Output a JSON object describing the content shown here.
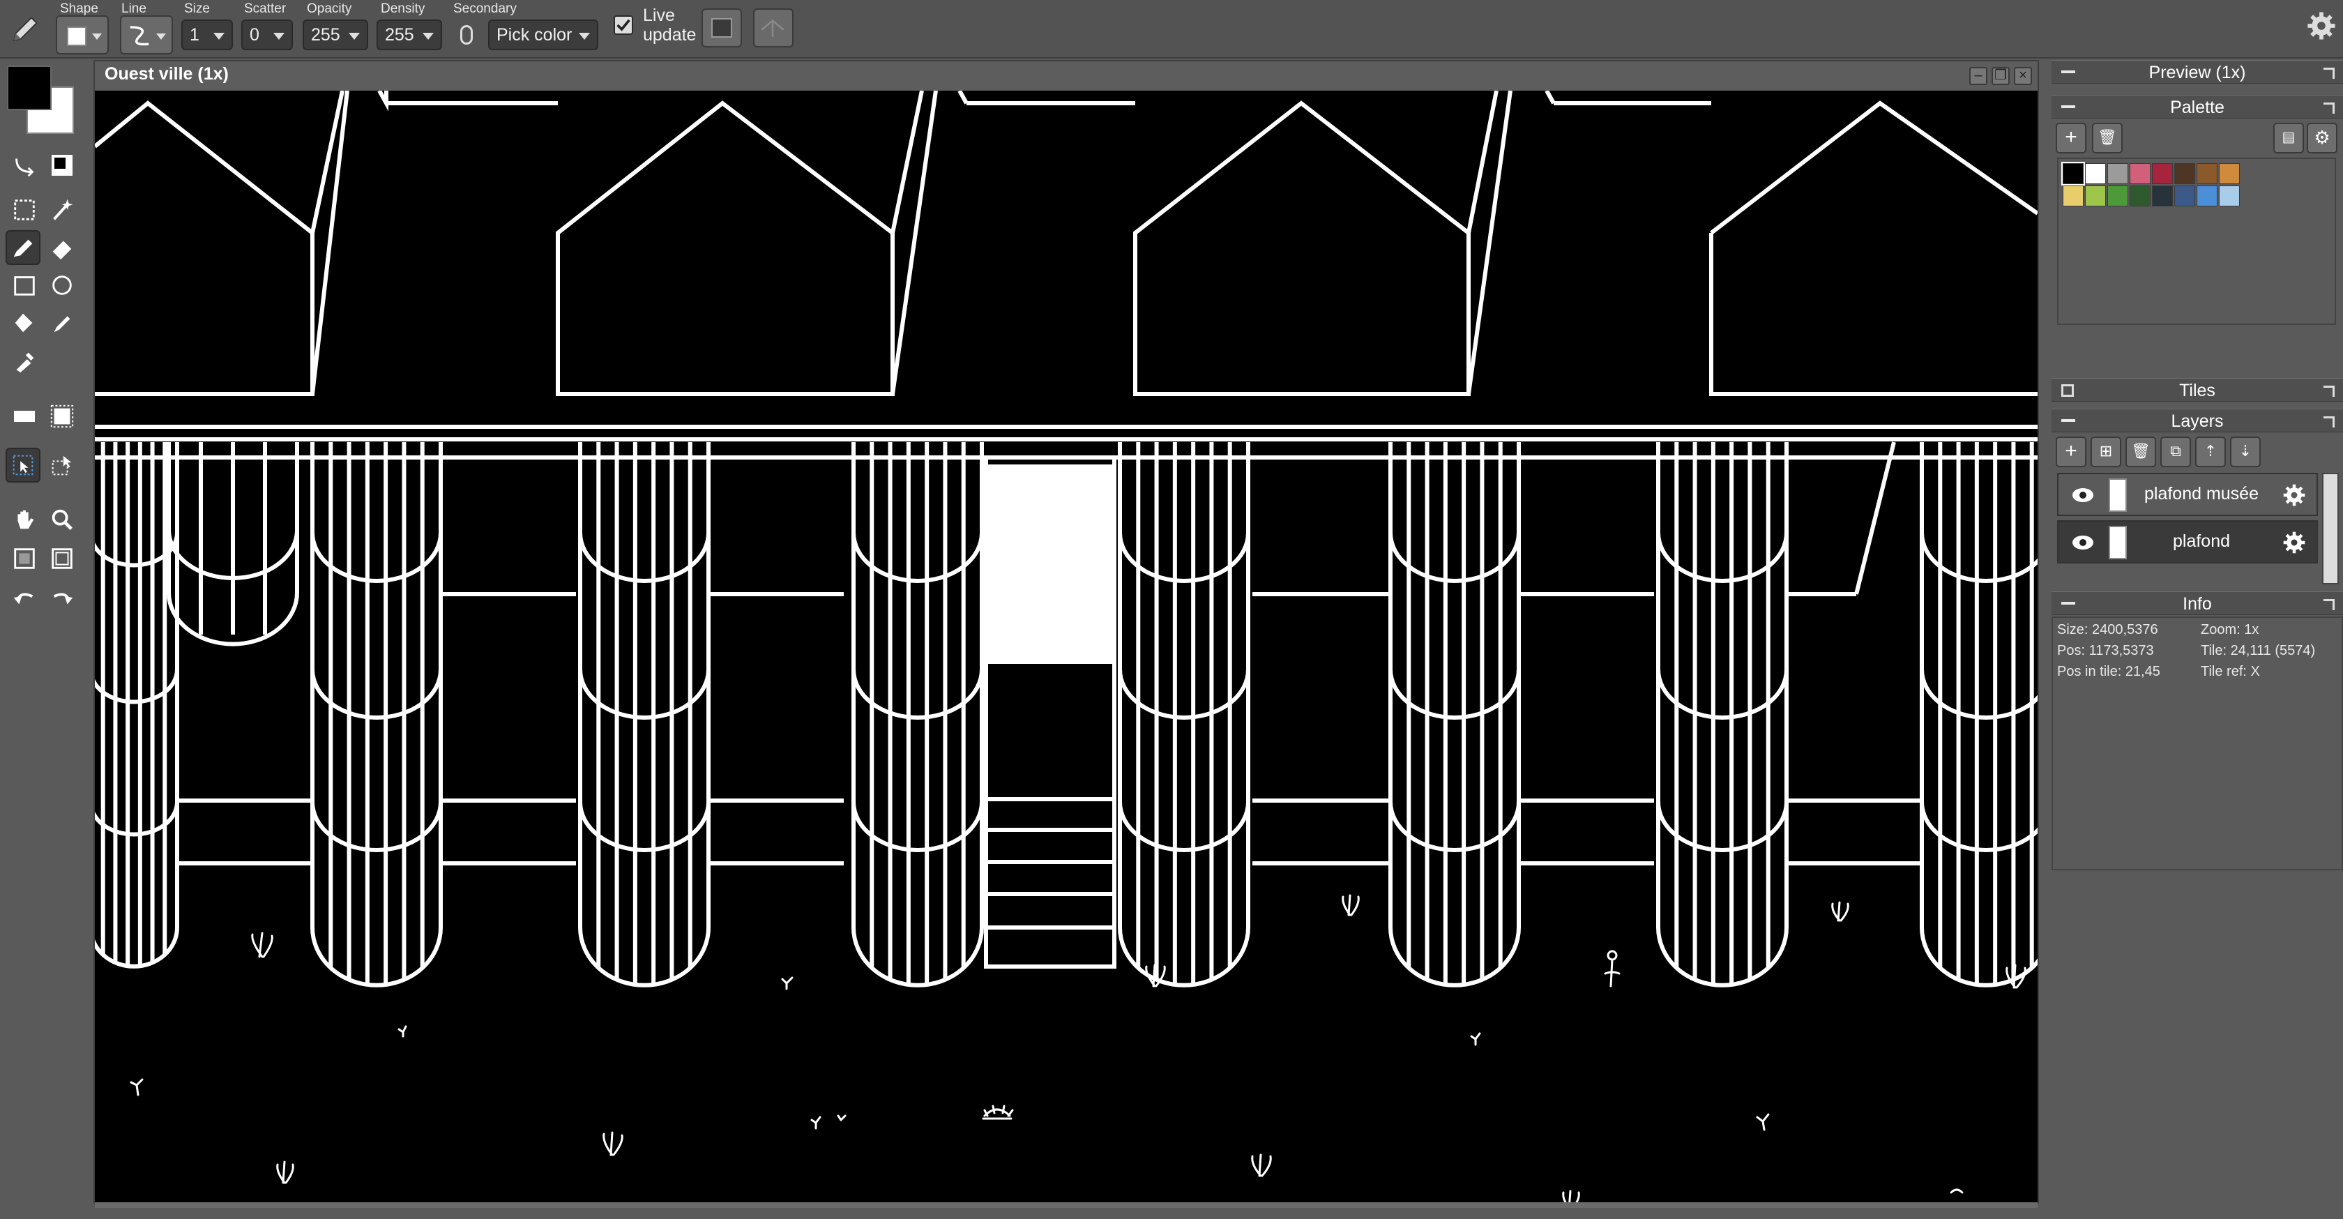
{
  "toolbar": {
    "shape_label": "Shape",
    "line_label": "Line",
    "size_label": "Size",
    "size_value": "1",
    "scatter_label": "Scatter",
    "scatter_value": "0",
    "opacity_label": "Opacity",
    "opacity_value": "255",
    "density_label": "Density",
    "density_value": "255",
    "secondary_label": "Secondary",
    "secondary_value": "Pick color",
    "live_update_label_1": "Live",
    "live_update_label_2": "update",
    "live_update_checked": true
  },
  "colors": {
    "foreground": "#000000",
    "background": "#ffffff",
    "panel_bg": "#5a5a5a",
    "canvas_bg": "#000000",
    "line_color": "#ffffff"
  },
  "document": {
    "title": "Ouest ville   (1x)"
  },
  "panels": {
    "preview": {
      "title": "Preview (1x)"
    },
    "palette": {
      "title": "Palette",
      "swatches": [
        "#000000",
        "#ffffff",
        "#9b9b9b",
        "#d2607a",
        "#a8243c",
        "#4e3524",
        "#8a5a2a",
        "#d08a3c",
        "#e8cd6a",
        "#9ec64a",
        "#4e9a3a",
        "#2f5a2e",
        "#27323a",
        "#3b5a8a",
        "#4b8fd6",
        "#a8cdea"
      ]
    },
    "tiles": {
      "title": "Tiles"
    },
    "layers": {
      "title": "Layers",
      "items": [
        {
          "name": "plafond musée",
          "visible": true,
          "selected": false
        },
        {
          "name": "plafond",
          "visible": true,
          "selected": true
        }
      ]
    },
    "info": {
      "title": "Info",
      "size": "Size: 2400,5376",
      "zoom": "Zoom: 1x",
      "pos": "Pos: 1173,5373",
      "tile": "Tile: 24,111 (5574)",
      "pos_in_tile": "Pos in tile: 21,45",
      "tile_ref": "Tile ref: X"
    }
  },
  "icons": [
    "pencil-icon",
    "shape-square-icon",
    "line-curve-icon",
    "mouse-icon",
    "gear-icon",
    "select-rect-icon",
    "magic-wand-icon",
    "brush-icon",
    "eraser-icon",
    "rectangle-icon",
    "ellipse-icon",
    "fill-icon",
    "eyedropper-icon",
    "hand-icon",
    "zoom-icon",
    "undo-icon",
    "redo-icon",
    "eye-icon"
  ]
}
